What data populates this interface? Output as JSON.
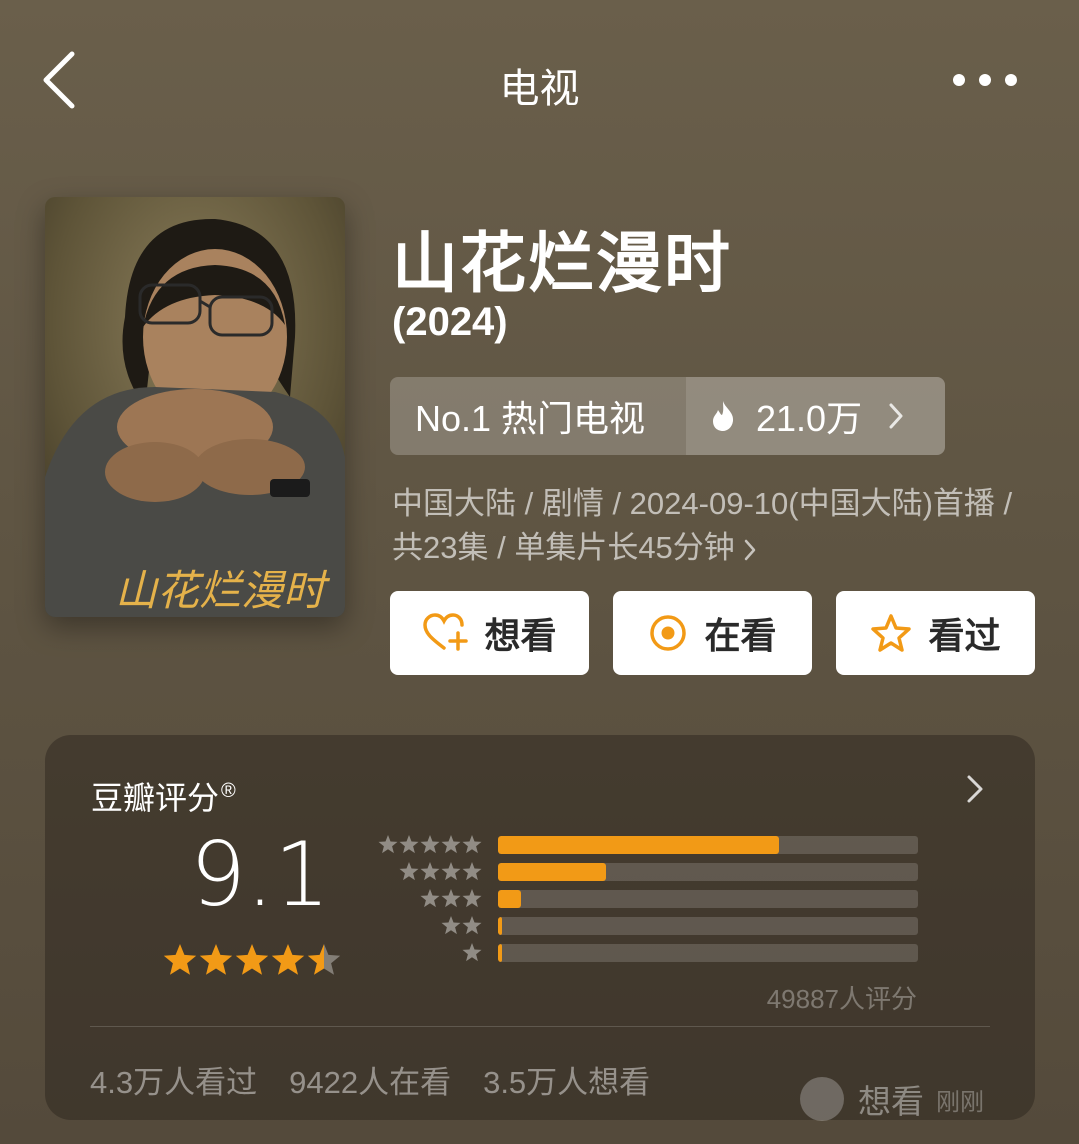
{
  "header": {
    "title": "电视"
  },
  "show": {
    "title": "山花烂漫时",
    "year": "(2024)",
    "poster_text": "山花烂漫时"
  },
  "ranking": {
    "rank_label": "No.1 热门电视",
    "heat": "21.0万"
  },
  "meta": {
    "info": "中国大陆 / 剧情 / 2024-09-10(中国大陆)首播 / 共23集 / 单集片长45分钟"
  },
  "actions": {
    "want": "想看",
    "watching": "在看",
    "watched": "看过"
  },
  "rating": {
    "label": "豆瓣评分",
    "reg": "®",
    "score": "9.1",
    "stars": 4.5,
    "distribution": [
      {
        "stars": 5,
        "fraction": 0.668
      },
      {
        "stars": 4,
        "fraction": 0.257
      },
      {
        "stars": 3,
        "fraction": 0.055
      },
      {
        "stars": 2,
        "fraction": 0.008
      },
      {
        "stars": 1,
        "fraction": 0.008
      }
    ],
    "count_text": "49887人评分",
    "watched": "4.3万人看过",
    "watching": "9422人在看",
    "want": "3.5万人想看"
  },
  "toast": {
    "text": "想看",
    "time": "刚刚"
  },
  "colors": {
    "accent": "#f29a16",
    "background": "#5f5543"
  }
}
